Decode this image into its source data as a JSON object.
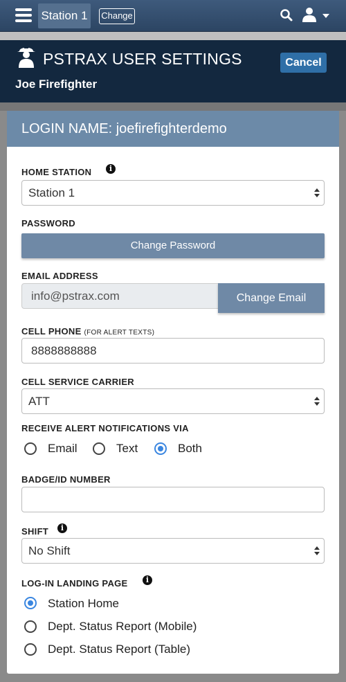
{
  "nav": {
    "station": "Station 1",
    "change_label": "Change"
  },
  "header": {
    "title": "PSTRAX USER SETTINGS",
    "user": "Joe Firefighter",
    "cancel_label": "Cancel"
  },
  "card": {
    "title": "LOGIN NAME: joefirefighterdemo"
  },
  "form": {
    "home_station": {
      "label": "HOME STATION",
      "value": "Station 1"
    },
    "password": {
      "label": "PASSWORD",
      "button": "Change Password"
    },
    "email": {
      "label": "EMAIL ADDRESS",
      "value": "info@pstrax.com",
      "button": "Change Email"
    },
    "cell_phone": {
      "label": "CELL PHONE",
      "hint": "(FOR ALERT TEXTS)",
      "value": "8888888888"
    },
    "carrier": {
      "label": "CELL SERVICE CARRIER",
      "value": "ATT"
    },
    "notify": {
      "label": "RECEIVE ALERT NOTIFICATIONS VIA",
      "options": [
        "Email",
        "Text",
        "Both"
      ],
      "selected": "Both"
    },
    "badge": {
      "label": "BADGE/ID NUMBER",
      "value": ""
    },
    "shift": {
      "label": "SHIFT",
      "value": "No Shift"
    },
    "landing": {
      "label": "LOG-IN LANDING PAGE",
      "options": [
        "Station Home",
        "Dept. Status Report (Mobile)",
        "Dept. Status Report (Table)"
      ],
      "selected": "Station Home"
    }
  },
  "colors": {
    "nav": "#2c4563",
    "header": "#13283f",
    "card_head": "#6c8aa8",
    "button": "#6f89a6",
    "cancel": "#2f6fa7",
    "radio_on": "#3a86e0"
  }
}
